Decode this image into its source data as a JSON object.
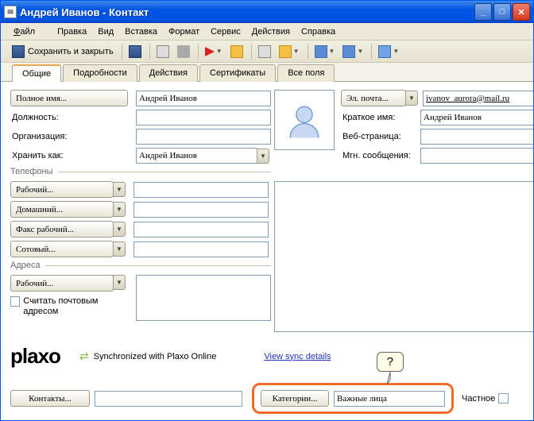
{
  "window": {
    "title": "Андрей Иванов - Контакт"
  },
  "menu": {
    "file": "Файл",
    "edit": "Правка",
    "view": "Вид",
    "insert": "Вставка",
    "format": "Формат",
    "service": "Сервис",
    "actions": "Действия",
    "help": "Справка"
  },
  "toolbar": {
    "save_close": "Сохранить и закрыть"
  },
  "tabs": {
    "general": "Общие",
    "details": "Подробности",
    "actions": "Действия",
    "certs": "Сертификаты",
    "all": "Все поля"
  },
  "fields": {
    "fullname_btn": "Полное имя...",
    "fullname_val": "Андрей Иванов",
    "position_lbl": "Должность:",
    "position_val": "",
    "org_lbl": "Организация:",
    "org_val": "",
    "fileas_lbl": "Хранить как:",
    "fileas_val": "Андрей Иванов",
    "email_btn": "Эл. почта...",
    "email_val": "ivanov_aurora@mail.ru",
    "shortname_lbl": "Краткое имя:",
    "shortname_val": "Андрей Иванов",
    "web_lbl": "Веб-страница:",
    "web_val": "",
    "im_lbl": "Мгн. сообщения:",
    "im_val": ""
  },
  "phones": {
    "legend": "Телефоны",
    "work": "Рабочий...",
    "home": "Домашний...",
    "fax": "Факс рабочий...",
    "mobile": "Сотовый..."
  },
  "addresses": {
    "legend": "Адреса",
    "work": "Рабочий...",
    "mail_cb": "Считать почтовым адресом"
  },
  "sync": {
    "label": "Synchronized with Plaxo Online",
    "link": "View sync details",
    "logo": "plaxo"
  },
  "bottom": {
    "contacts": "Контакты...",
    "categories": "Категории...",
    "categories_val": "Важные лица",
    "private": "Частное"
  },
  "callout": {
    "text": "?"
  }
}
